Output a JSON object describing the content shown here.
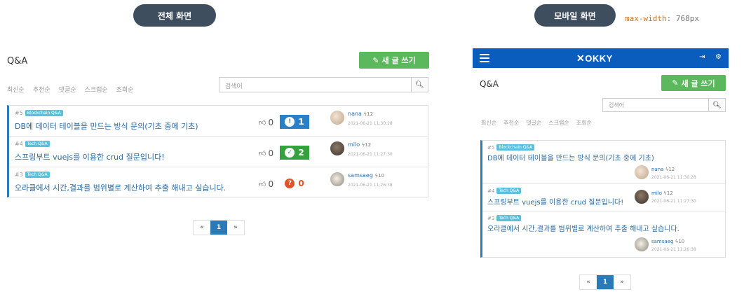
{
  "labels": {
    "desktop_view": "전체 화면",
    "mobile_view": "모바일 화면",
    "media_key": "max-width",
    "media_value": ": 768px"
  },
  "board": {
    "title": "Q&A",
    "write_button": "새 글 쓰기",
    "search_placeholder": "검색어",
    "sort_options": [
      "최신순",
      "추천순",
      "댓글순",
      "스크랩순",
      "조회순"
    ]
  },
  "posts": [
    {
      "number": "#5",
      "tag": "Blockchain Q&A",
      "title": "DB에 데이터 테이블을 만드는 방식 문의(기초 중에 기초)",
      "likes": "0",
      "answers": "1",
      "answer_state": "open",
      "author": "nana",
      "score": "12",
      "date": "2021-06-21 11:30:28"
    },
    {
      "number": "#4",
      "tag": "Tech Q&A",
      "title": "스프링부트 vuejs를 이용한 crud 질문입니다!",
      "likes": "0",
      "answers": "2",
      "answer_state": "accepted",
      "author": "milo",
      "score": "12",
      "date": "2021-06-21 11:27:30"
    },
    {
      "number": "#3",
      "tag": "Tech Q&A",
      "title": "오라클에서 시간,결과를 범위별로 계산하여 추출 해내고 싶습니다.",
      "likes": "0",
      "answers": "0",
      "answer_state": "none",
      "author": "samsaeg",
      "score": "10",
      "date": "2021-06-21 11:26:38"
    }
  ],
  "pagination": {
    "prev": "«",
    "current": "1",
    "next": "»"
  },
  "mobile_nav": {
    "logo": "OKKY",
    "logo_mark": "✕"
  },
  "icons": {
    "pencil": "pencil-icon",
    "search": "search-icon",
    "thumbs_up": "thumbs-up-icon",
    "menu": "hamburger-icon",
    "sign_out": "sign-out-icon",
    "gear": "gear-icon"
  },
  "colors": {
    "nav": "#0b5dbd",
    "write_button": "#5cb85c",
    "tag": "#5bc0de",
    "answer_open": "#2780c8",
    "answer_accepted": "#33a23c",
    "answer_none": "#e05227",
    "pill": "#3f4e5f"
  }
}
